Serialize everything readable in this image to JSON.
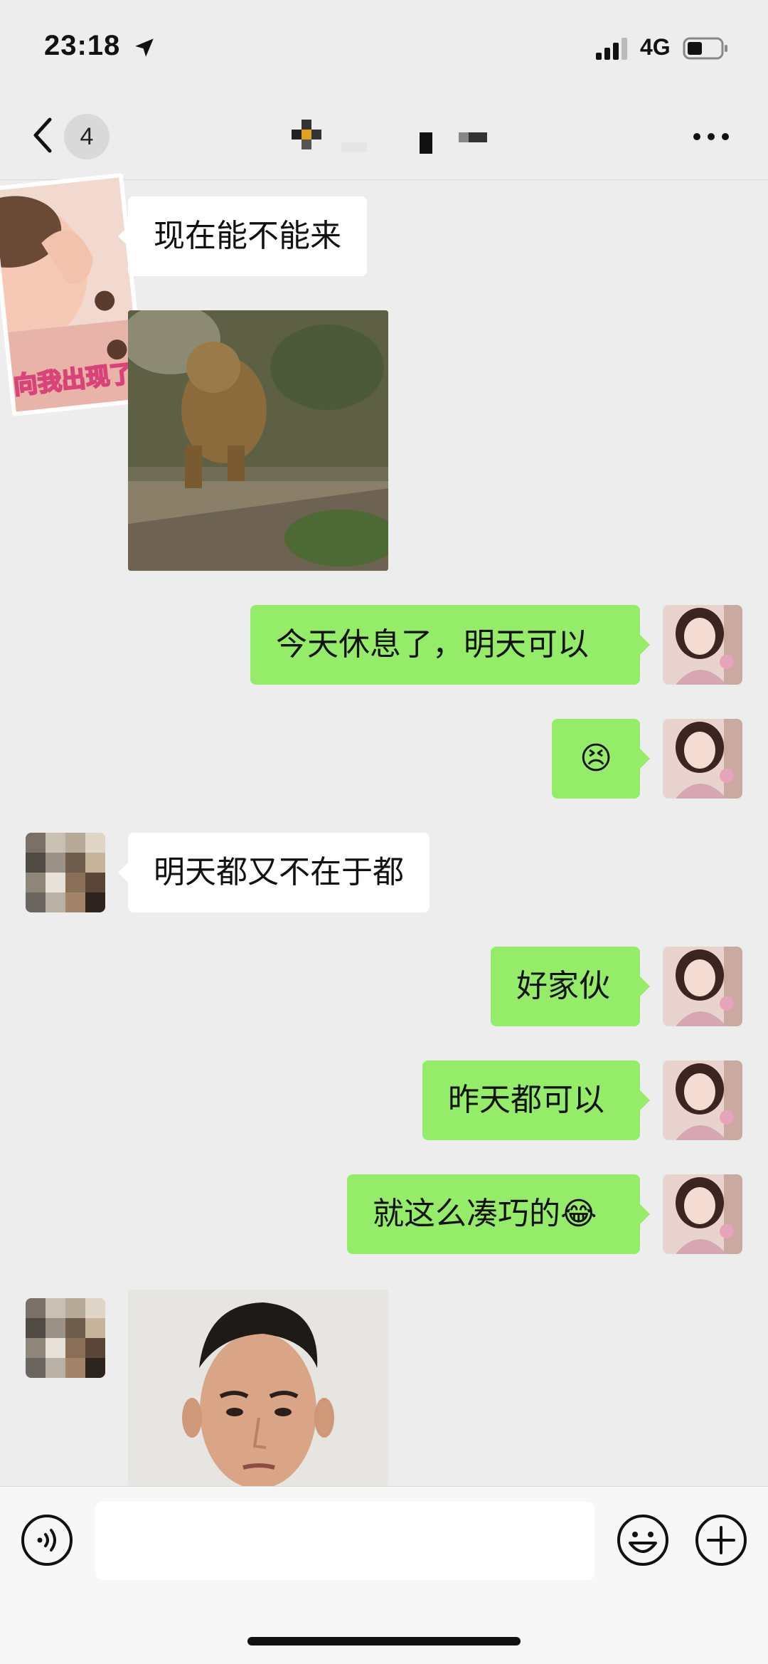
{
  "status_bar": {
    "time": "23:18",
    "network": "4G",
    "icons": [
      "location-arrow-icon",
      "signal-bars-icon",
      "battery-icon"
    ]
  },
  "nav": {
    "unread_count": "4",
    "icons": [
      "chevron-left-icon",
      "more-icon"
    ]
  },
  "messages": [
    {
      "side": "in",
      "type": "sticker",
      "caption": "向我出现了"
    },
    {
      "side": "in",
      "type": "text",
      "text": "现在能不能来"
    },
    {
      "side": "in",
      "type": "image"
    },
    {
      "side": "out",
      "type": "text",
      "text": "今天休息了，明天可以"
    },
    {
      "side": "out",
      "type": "emoji",
      "text": "😣"
    },
    {
      "side": "in",
      "type": "text",
      "text": "明天都又不在于都"
    },
    {
      "side": "out",
      "type": "text",
      "text": "好家伙"
    },
    {
      "side": "out",
      "type": "text",
      "text": "昨天都可以"
    },
    {
      "side": "out",
      "type": "text",
      "text": "就这么凑巧的😂"
    },
    {
      "side": "in",
      "type": "image"
    }
  ],
  "input_bar": {
    "placeholder": "",
    "icons": [
      "voice-icon",
      "emoji-icon",
      "plus-icon"
    ]
  },
  "colors": {
    "background": "#ededed",
    "incoming_bubble": "#ffffff",
    "outgoing_bubble": "#95ec69",
    "input_bar": "#f7f7f7"
  }
}
